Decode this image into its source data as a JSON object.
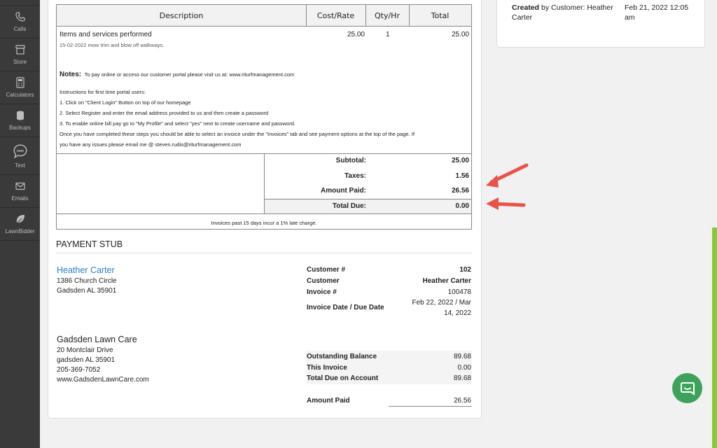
{
  "sidebar": {
    "items": [
      {
        "label": "Calls",
        "icon": "phone-icon"
      },
      {
        "label": "Store",
        "icon": "store-icon"
      },
      {
        "label": "Calculators",
        "icon": "calculator-icon"
      },
      {
        "label": "Backups",
        "icon": "database-icon"
      },
      {
        "label": "Text",
        "icon": "sms-icon"
      },
      {
        "label": "Emails",
        "icon": "envelope-icon"
      },
      {
        "label": "LawnBidder",
        "icon": "leaf-icon"
      }
    ]
  },
  "activity": {
    "created_bold": "Created",
    "created_rest": " by Customer: Heather",
    "created_rest2": "Carter",
    "date_line1": "Feb 21, 2022 12:05",
    "date_line2": "am"
  },
  "invoice_table": {
    "headers": {
      "description": "Description",
      "cost": "Cost/Rate",
      "qty": "Qty/Hr",
      "total": "Total"
    },
    "item": {
      "name": "Items and services performed",
      "detail": "15-02-2022 mow trim and blow off walkways.",
      "cost": "25.00",
      "qty": "1",
      "total": "25.00"
    },
    "notes_label": "Notes:",
    "notes_text": "To pay online or access our customer portal please visit us at: www.riturfmanagement.com",
    "instructions": [
      "Instructions for first time portal users:",
      "1. Click on \"Client Login\" Button on top of our homepage",
      "2. Select Register and enter the email address provided to us and then create a password",
      "3. To enable online bill pay go to \"My Profile\" and select \"yes\" next to create username and password.",
      "Once you have completed these steps you should be able to select an invoice under the \"Invoices\" tab and see payment options at the top of the page. If",
      "you have any issues please email me @ steven.rudis@riturfmanagement.com"
    ],
    "totals": {
      "subtotal_label": "Subtotal:",
      "subtotal": "25.00",
      "taxes_label": "Taxes:",
      "taxes": "1.56",
      "paid_label": "Amount Paid:",
      "paid": "26.56",
      "due_label": "Total Due:",
      "due": "0.00"
    },
    "late_note": "Invoices past 15 days incur a 1% late charge."
  },
  "stub": {
    "title": "PAYMENT STUB",
    "customer_name": "Heather Carter",
    "customer_addr1": "1386 Church Circle",
    "customer_addr2": "Gadsden AL 35901",
    "company_name": "Gadsden Lawn Care",
    "company_addr1": "20 Montclair Drive",
    "company_addr2": "gadsden AL 35901",
    "company_phone": "205-369-7052",
    "company_web": "www.GadsdenLawnCare.com",
    "fields": {
      "cust_no_label": "Customer #",
      "cust_no": "102",
      "cust_label": "Customer",
      "cust": "Heather Carter",
      "inv_label": "Invoice #",
      "inv": "100478",
      "date_label": "Invoice Date / Due Date",
      "date1": "Feb 22, 2022 / Mar",
      "date2": "14, 2022"
    },
    "balance": {
      "outstanding_label": "Outstanding Balance",
      "outstanding": "89.68",
      "this_label": "This Invoice",
      "this": "0.00",
      "total_label": "Total Due on Account",
      "total": "89.68",
      "paid_label": "Amount Paid",
      "paid": "26.56"
    }
  },
  "colors": {
    "sidebar": "#3a3a3a",
    "link": "#2a7fc0",
    "arrow": "#e9534a",
    "chat": "#3da35a",
    "scroll": "#8cc63f"
  }
}
